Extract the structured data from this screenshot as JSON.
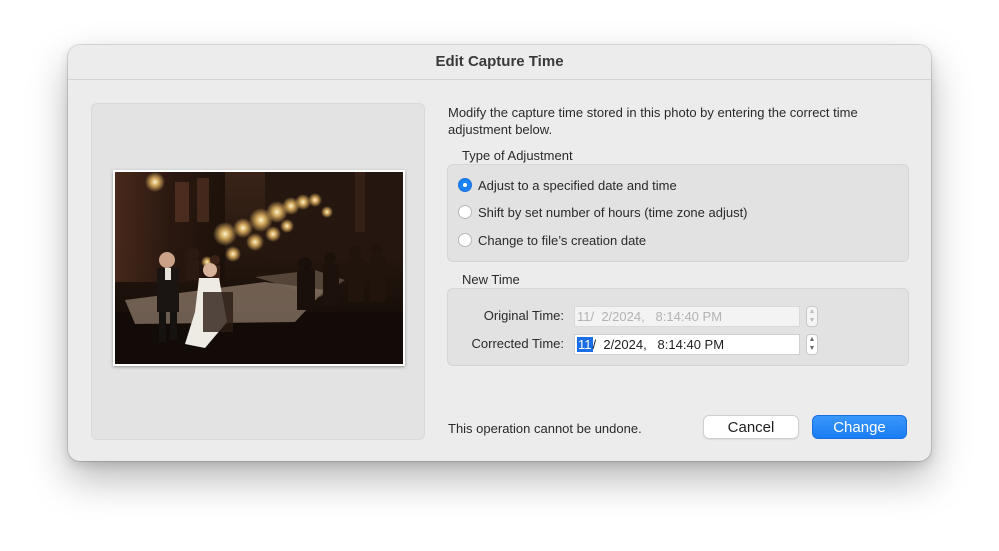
{
  "dialog": {
    "title": "Edit Capture Time",
    "description": "Modify the capture time stored in this photo by entering the correct time adjustment below."
  },
  "adjustment": {
    "label": "Type of Adjustment",
    "selected": "specified",
    "options": [
      {
        "id": "specified",
        "label": "Adjust to a specified date and time"
      },
      {
        "id": "shift",
        "label": "Shift by set number of hours (time zone adjust)"
      },
      {
        "id": "file",
        "label": "Change to file’s creation date"
      }
    ]
  },
  "new_time": {
    "label": "New Time",
    "original_label": "Original Time:",
    "original_value": "11/  2/2024,   8:14:40 PM",
    "corrected_label": "Corrected Time:",
    "corrected_month": "11",
    "corrected_rest": "/  2/2024,   8:14:40 PM"
  },
  "footer": {
    "warning": "This operation cannot be undone.",
    "cancel_label": "Cancel",
    "change_label": "Change"
  },
  "colors": {
    "accent": "#1a82f7",
    "dialog_bg": "#ececec",
    "group_bg": "#e2e2e2"
  },
  "icons": {
    "stepper": "up-down-stepper-icon",
    "radio": "radio-button-icon"
  }
}
